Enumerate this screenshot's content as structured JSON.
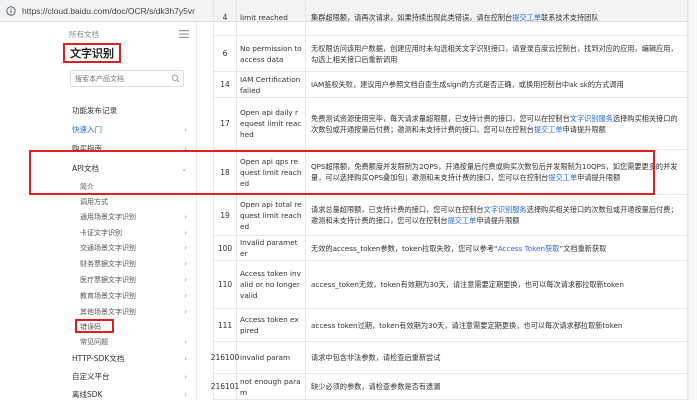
{
  "browser": {
    "url": "https://cloud.baidu.com/doc/OCR/s/dk3h7y5vr"
  },
  "sidebar": {
    "all_docs": "所有文档",
    "title": "文字识别",
    "search_placeholder": "搜索本产品文档",
    "items": [
      {
        "label": "功能发布记录",
        "chev": "",
        "sub": false
      },
      {
        "label": "快速入门",
        "chev": "›",
        "sub": false,
        "active": true
      },
      {
        "label": "购买指南",
        "chev": "›",
        "sub": false
      },
      {
        "label": "API文档",
        "chev": "⌄",
        "sub": false
      },
      {
        "label": "简介",
        "chev": "",
        "sub": true
      },
      {
        "label": "调用方式",
        "chev": "",
        "sub": true
      },
      {
        "label": "通用场景文字识别",
        "chev": "›",
        "sub": true
      },
      {
        "label": "卡证文字识别",
        "chev": "›",
        "sub": true
      },
      {
        "label": "交通场景文字识别",
        "chev": "›",
        "sub": true
      },
      {
        "label": "财务票据文字识别",
        "chev": "›",
        "sub": true
      },
      {
        "label": "医疗票据文字识别",
        "chev": "›",
        "sub": true
      },
      {
        "label": "教育场景文字识别",
        "chev": "›",
        "sub": true
      },
      {
        "label": "其他场景文字识别",
        "chev": "›",
        "sub": true
      },
      {
        "label": "错误码",
        "chev": "",
        "sub": true
      },
      {
        "label": "常见问题",
        "chev": "›",
        "sub": true
      },
      {
        "label": "HTTP-SDK文档",
        "chev": "›",
        "sub": false
      },
      {
        "label": "自定义平台",
        "chev": "›",
        "sub": false
      },
      {
        "label": "离线SDK",
        "chev": "›",
        "sub": false
      }
    ]
  },
  "table": {
    "rows": [
      {
        "code": "4",
        "msg": "limit reached",
        "desc_parts": [
          {
            "t": "集群超限额，请再次请求，如果持续出现此类错误，请在控制台"
          },
          {
            "t": "提交工单",
            "link": true
          },
          {
            "t": "联系技术支持团队"
          }
        ]
      },
      {
        "code": "6",
        "msg": "No permission to access data",
        "desc_parts": [
          {
            "t": "无权限访问该用户数据，创建应用时未勾选相关文字识别接口，请登录百度云控制台，找到对应的应用，编辑应用，勾选上相关接口后重新调用"
          }
        ]
      },
      {
        "code": "14",
        "msg": "IAM Certification failed",
        "desc_parts": [
          {
            "t": "IAM鉴权失败，建议用户参照文档自查生成sign的方式是否正确，或换用控制台中ak sk的方式调用"
          }
        ]
      },
      {
        "code": "17",
        "msg": "Open api daily request limit reached",
        "desc_parts": [
          {
            "t": "免费测试资源使用完毕，每天请求量超限额，已支持计费的接口，您可以在控制台"
          },
          {
            "t": "文字识别服务",
            "link": true
          },
          {
            "t": "选择购买相关接口的次数包或开通按量后付费；邀测和未支持计费的接口，您可以在控制台"
          },
          {
            "t": "提交工单",
            "link": true
          },
          {
            "t": "申请提升限额"
          }
        ]
      },
      {
        "code": "18",
        "msg": "Open api qps request limit reached",
        "desc_parts": [
          {
            "t": "QPS超限额，免费额度并发限制为2QPS，开通按量后付费或购买次数包后并发限制为10QPS，如您需要更多的并发量，可以选择购买QPS叠加包；邀测和未支持计费的接口，您可以在控制台"
          },
          {
            "t": "提交工单",
            "link": true
          },
          {
            "t": "申请提升限额"
          }
        ]
      },
      {
        "code": "19",
        "msg": "Open api total request limit reached",
        "desc_parts": [
          {
            "t": "请求总量超限额，已支持计费的接口，您可以在控制台"
          },
          {
            "t": "文字识别服务",
            "link": true
          },
          {
            "t": "选择购买相关接口的次数包或开通按量后付费；邀测和未支持计费的接口，您可以在控制台"
          },
          {
            "t": "提交工单",
            "link": true
          },
          {
            "t": "申请提升限额"
          }
        ]
      },
      {
        "code": "100",
        "msg": "Invalid parameter",
        "desc_parts": [
          {
            "t": "无效的access_token参数，token拉取失败，您可以参考“"
          },
          {
            "t": "Access Token获取",
            "link": true
          },
          {
            "t": "”文档重新获取"
          }
        ]
      },
      {
        "code": "110",
        "msg": "Access token invalid or no longer valid",
        "desc_parts": [
          {
            "t": "access_token无效，token有效期为30天，请注意需要定期更换，也可以每次请求都拉取新token"
          }
        ]
      },
      {
        "code": "111",
        "msg": "Access token expired",
        "desc_parts": [
          {
            "t": "access token过期，token有效期为30天，请注意需要定期更换，也可以每次请求都拉取新token"
          }
        ]
      },
      {
        "code": "216100",
        "msg": "invalid param",
        "desc_parts": [
          {
            "t": "请求中包含非法参数，请检查后重新尝试"
          }
        ]
      },
      {
        "code": "216101",
        "msg": "not enough param",
        "desc_parts": [
          {
            "t": "缺少必须的参数，请检查参数是否有遗漏"
          }
        ]
      }
    ]
  }
}
